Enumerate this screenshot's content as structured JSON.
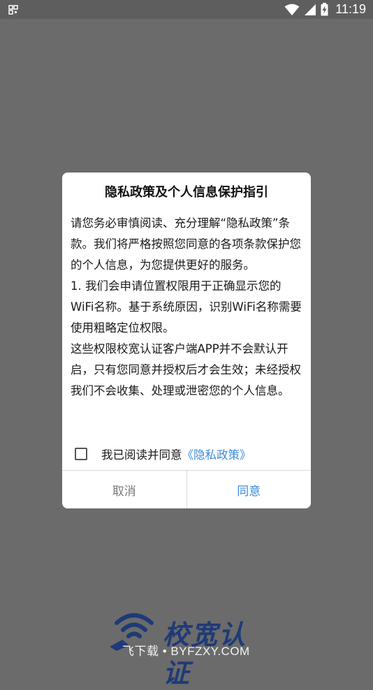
{
  "status_bar": {
    "time": "11:19",
    "icons": [
      "notification-icon",
      "wifi-icon",
      "cellular-signal-icon",
      "battery-charging-icon"
    ]
  },
  "dialog": {
    "title": "隐私政策及个人信息保护指引",
    "paragraphs": [
      "请您务必审慎阅读、充分理解“隐私政策”条款。我们将严格按照您同意的各项条款保护您的个人信息，为您提供更好的服务。",
      "1. 我们会申请位置权限用于正确显示您的WiFi名称。基于系统原因，识别WiFi名称需要使用粗略定位权限。",
      "这些权限校宽认证客户端APP并不会默认开启，只有您同意并授权后才会生效；未经授权我们不会收集、处理或泄密您的个人信息。"
    ],
    "agree_text": "我已阅读并同意",
    "agree_link": "《隐私政策》",
    "agree_checked": false,
    "cancel_label": "取消",
    "confirm_label": "同意"
  },
  "background": {
    "logo_text": "校宽认证",
    "watermark": "飞下载 • BYFZXY.COM"
  },
  "colors": {
    "overlay": "#6b6b6b",
    "accent": "#3b8ad8",
    "logo": "#1e3a78"
  }
}
